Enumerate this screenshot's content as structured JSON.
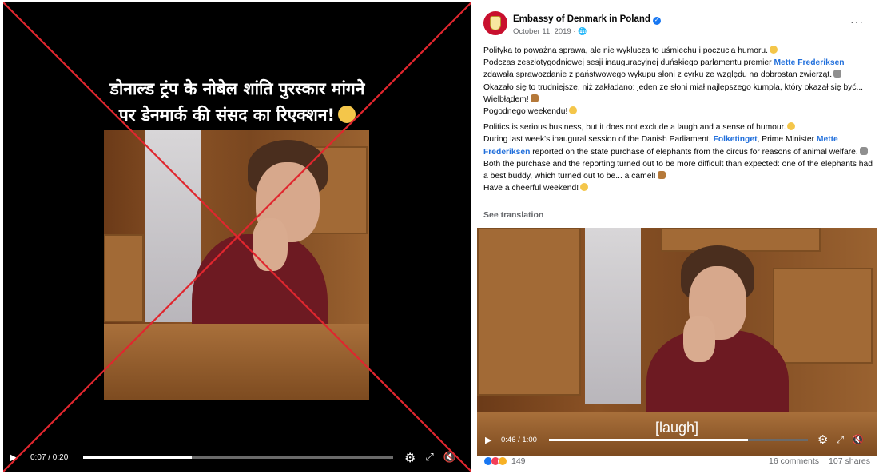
{
  "left_post": {
    "caption_line1": "डोनाल्ड ट्रंप के नोबेल शांति पुरस्कार मांगने",
    "caption_line2": "पर डेनमार्क की संसद का रिएक्शन!",
    "caption_emoji": "laughing-face-icon",
    "player": {
      "time": "0:07 / 0:20",
      "progress": 0.35
    },
    "overlay_color": "#e0262e"
  },
  "right_post": {
    "page_name": "Embassy of Denmark in Poland",
    "date": "October 11, 2019 · ",
    "more_label": "···",
    "polish": {
      "p1": "Polityka to poważna sprawa, ale nie wyklucza to uśmiechu i poczucia humoru.",
      "p2a": "Podczas zeszłotygodniowej sesji inauguracyjnej duńskiego parlamentu premier ",
      "p2_link": "Mette Frederiksen",
      "p2b": "zdawała sprawozdanie z państwowego wykupu słoni z cyrku ze względu na dobrostan zwierząt.",
      "p3": "Okazało się to trudniejsze, niż zakładano: jeden ze słoni miał najlepszego kumpla, który okazał się być... Wielbłądem!",
      "p4": "Pogodnego weekendu!"
    },
    "english": {
      "p1": "Politics is serious business, but it does not exclude a laugh and a sense of humour.",
      "p2a": "During last week's inaugural session of the Danish Parliament, ",
      "p2_link1": "Folketinget",
      "p2b": ", Prime Minister ",
      "p2_link2a": "Mette",
      "p2_link2b": "Frederiksen",
      "p2c": " reported on the state purchase of elephants from the circus for reasons of animal welfare.",
      "p3": "Both the purchase and the reporting turned out to be more difficult than expected: one of the elephants had a best buddy, which turned out to be... a camel!",
      "p4": "Have a cheerful weekend!"
    },
    "see_translation": "See translation",
    "player": {
      "time": "0:46 / 1:00",
      "progress": 0.77,
      "subtitle": "[laugh]"
    },
    "footer": {
      "reactions": "149",
      "comments": "16 comments",
      "shares": "107 shares"
    }
  }
}
